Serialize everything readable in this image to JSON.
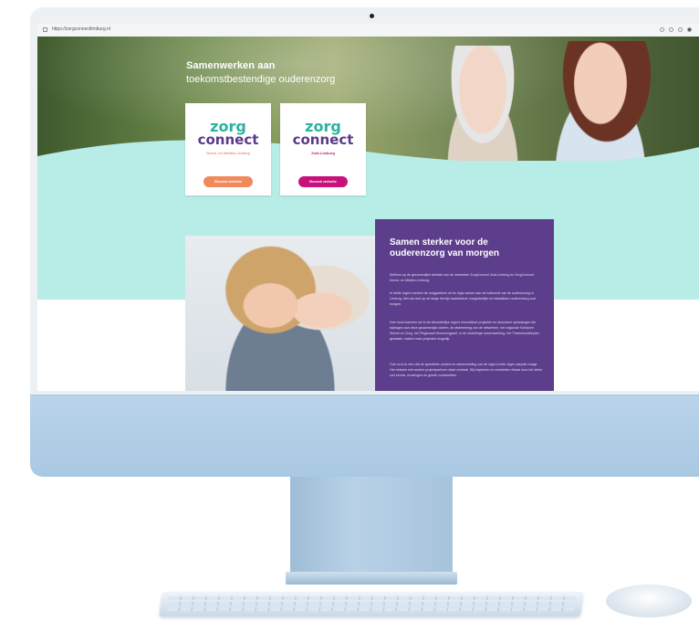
{
  "browser": {
    "url": "https://zorgconnectlimburg.nl"
  },
  "hero": {
    "title": "Samenwerken aan",
    "subtitle": "toekomstbestendige ouderenzorg"
  },
  "cards": [
    {
      "logo_top": "zorg",
      "logo_bottom": "connect",
      "region": "Noord- en Midden-Limburg",
      "button": "Bezoek website"
    },
    {
      "logo_top": "zorg",
      "logo_bottom": "connect",
      "region": "Zuid-Limburg",
      "button": "Bezoek website"
    }
  ],
  "about": {
    "title": "Samen sterker voor de ouderenzorg van morgen",
    "paragraphs": [
      "Welkom op de gezamenlijke website van de netwerken ZorgConnect Zuid-Limburg en ZorgConnect Noord- en Midden-Limburg.",
      "In beide regio's werken de zorgpartners uit de regio samen aan de toekomst van de ouderenzorg in Limburg. Met als doel op de lange termijn kwalitatieve, toegankelijke en betaalbare ouderenzorg voor morgen.",
      "Hoe mooi wanneer we in de afzonderlijke regio's innovatieve projecten en duurzame oplossingen die bijdragen aan deze gezamenlijke doelen, de afstemming van de netwerken, het regionale Schrijven Wonen en Zorg, het 'Regionaal Woonzorgpact', in de onderlinge samenwerking, het 'Transformatieplan' gemaakt, maken onze projecten mogelijk.",
      "Ook nu is te zien dat de specifieke context en samenstelling van de regio's ieder eigen aanpak vraagt. Het netwerk met andere projectpartners staat centraal. Wij inspireren en versterken elkaar door het delen van kennis, ervaringen en goede voorbeelden."
    ]
  },
  "colors": {
    "purple": "#5d3e8c",
    "mint": "#b8ece6",
    "teal_logo": "#2bb3a0",
    "orange_button": "#f08a5d",
    "magenta_button": "#c8117a"
  }
}
